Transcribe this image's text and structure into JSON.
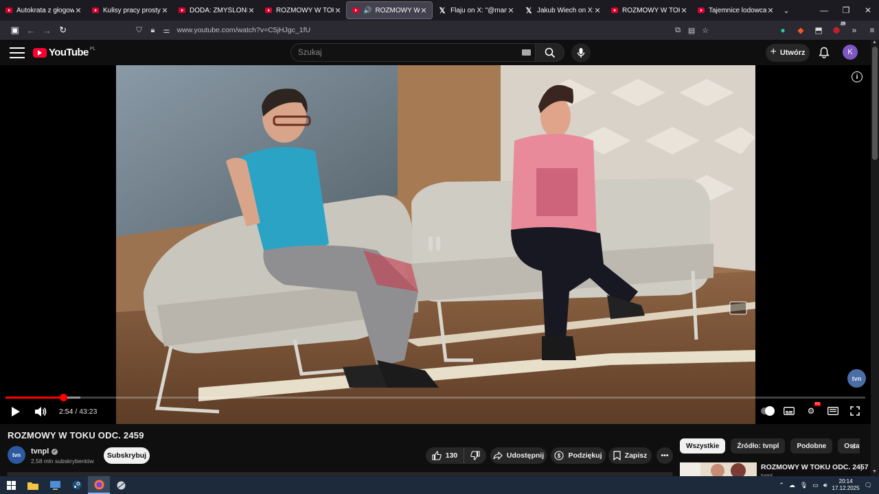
{
  "browser": {
    "tabs": [
      {
        "label": "Autokrata z głogowskiej",
        "icon": "youtube-icon",
        "active": false
      },
      {
        "label": "Kulisy pracy prostytutki",
        "icon": "youtube-icon",
        "active": false
      },
      {
        "label": "DODA: ZMYŚLONE ŻYCIE",
        "icon": "youtube-icon",
        "active": false
      },
      {
        "label": "ROZMOWY W TOKU ODC",
        "icon": "youtube-icon",
        "active": false
      },
      {
        "label": "ROZMOWY W TOKU",
        "icon": "youtube-icon",
        "active": true
      },
      {
        "label": "Flaju on X: \"@mamiczi @",
        "icon": "x-icon",
        "active": false
      },
      {
        "label": "Jakub Wiech on X: \"Zrob",
        "icon": "x-icon",
        "active": false
      },
      {
        "label": "ROZMOWY W TOKU ODC",
        "icon": "youtube-icon",
        "active": false
      },
      {
        "label": "Tajemnice lodowca - You",
        "icon": "youtube-icon",
        "active": false
      }
    ],
    "url": "www.youtube.com/watch?v=C5jHJgc_1fU",
    "extensions_badge": "29"
  },
  "youtube": {
    "logo_text": "YouTube",
    "logo_region": "PL",
    "search_placeholder": "Szukaj",
    "create_label": "Utwórz",
    "avatar_letter": "K",
    "accent": "#ff0033"
  },
  "player": {
    "current_time": "2:54",
    "duration": "43:23",
    "time_separator": "/",
    "played_fraction": 0.067,
    "buffered_fraction": 0.087,
    "watermark": "tvn"
  },
  "video_info": {
    "title": "ROZMOWY W TOKU ODC. 2459",
    "channel_name": "tvnpl",
    "channel_avatar_text": "tvn",
    "subscribers": "2,58 mln subskrybentów",
    "subscribe_label": "Subskrybuj",
    "likes": "130",
    "share_label": "Udostępnij",
    "thanks_label": "Podziękuj",
    "save_label": "Zapisz"
  },
  "filter_chips": [
    "Wszystkie",
    "Źródło: tvnpl",
    "Podobne",
    "Ostatnio"
  ],
  "recommendation": {
    "title": "ROZMOWY W TOKU ODC. 2457",
    "channel": "tvnpl"
  },
  "taskbar": {
    "time": "20:14",
    "date": "17.12.2025"
  }
}
